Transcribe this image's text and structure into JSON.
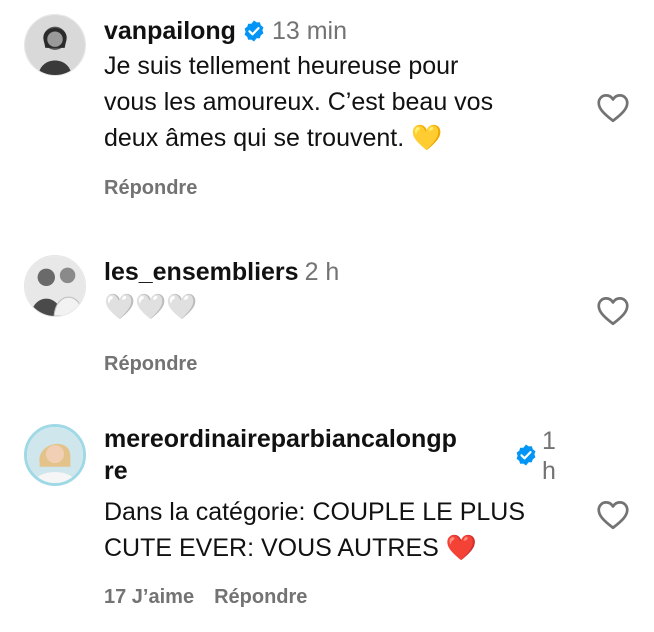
{
  "comments": [
    {
      "username": "vanpailong",
      "verified": true,
      "time": "13 min",
      "text": "Je suis tellement heureuse pour\nvous les amoureux. C’est beau vos\ndeux âmes qui se trouvent. 💛",
      "reply_label": "Répondre",
      "avatar_icon": "profile-photo-woman"
    },
    {
      "username": "les_ensembliers",
      "verified": false,
      "time": "2 h",
      "text": "🤍🤍🤍",
      "reply_label": "Répondre",
      "avatar_icon": "profile-photo-two-men"
    },
    {
      "username_line1": "mereordinaireparbiancalongp",
      "username_line2": "re",
      "verified": true,
      "time_line1": "1",
      "time_line2": "h",
      "text": "Dans la catégorie: COUPLE LE PLUS\nCUTE EVER: VOUS AUTRES ❤️",
      "likes_label": "17 J’aime",
      "reply_label": "Répondre",
      "avatar_icon": "profile-photo-blonde-woman"
    }
  ],
  "icons": {
    "like": "heart-outline-icon",
    "verified": "verified-badge-icon"
  },
  "colors": {
    "verified_blue": "#0095f6",
    "muted": "#737373",
    "text": "#111111"
  }
}
